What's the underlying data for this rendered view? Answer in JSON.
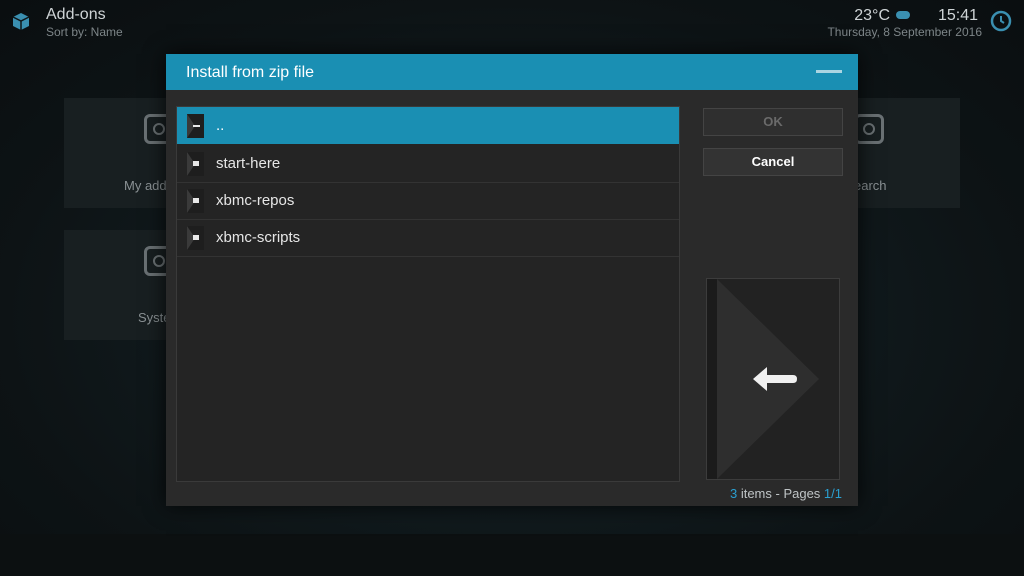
{
  "header": {
    "title": "Add-ons",
    "subtitle": "Sort by: Name",
    "temperature": "23°C",
    "time": "15:41",
    "date": "Thursday, 8 September 2016"
  },
  "background_tiles": [
    {
      "label": "My add"
    },
    {
      "label": "earch"
    },
    {
      "label": "Syste"
    }
  ],
  "dialog": {
    "title": "Install from zip file",
    "items": [
      {
        "label": "..",
        "kind": "parent"
      },
      {
        "label": "start-here",
        "kind": "folder"
      },
      {
        "label": "xbmc-repos",
        "kind": "folder"
      },
      {
        "label": "xbmc-scripts",
        "kind": "folder"
      }
    ],
    "ok_label": "OK",
    "cancel_label": "Cancel",
    "pager": {
      "count": "3",
      "items_text": " items - Pages ",
      "pages": "1/1"
    }
  },
  "colors": {
    "accent": "#1a8fb3",
    "dialog_bg": "#2a2a2a"
  }
}
